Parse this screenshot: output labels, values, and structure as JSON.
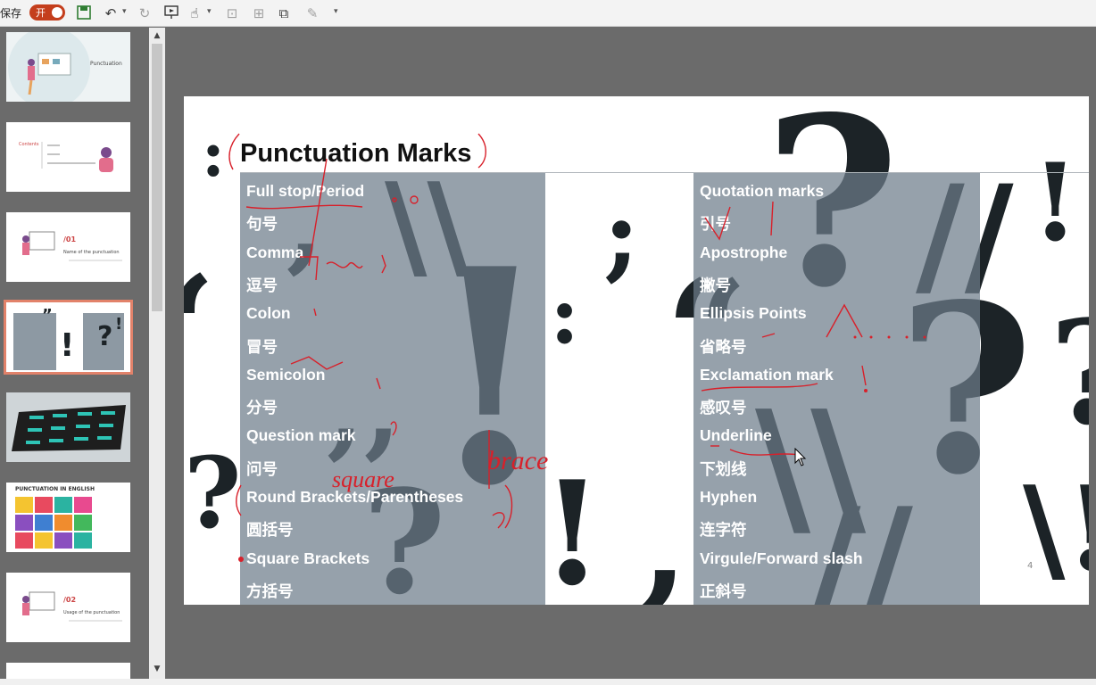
{
  "toolbar": {
    "autosave_label": "保存",
    "autosave_toggle": "开"
  },
  "thumbnails": {
    "slide1_title": "Punctuation",
    "slide2_title": "Contents",
    "slide3_num": "/01",
    "slide3_text": "Name of the punctuation",
    "slide6_title": "PUNCTUATION IN ENGLISH",
    "slide7_num": "/02",
    "slide7_text": "Usage of the punctuation"
  },
  "slide": {
    "title": "Punctuation Marks",
    "page_number": "4",
    "left_items": [
      "Full stop/Period",
      "句号",
      "Comma",
      "逗号",
      "Colon",
      "冒号",
      "Semicolon",
      "分号",
      "Question mark",
      " 问号",
      "Round Brackets/Parentheses",
      "圆括号",
      "Square Brackets",
      "方括号"
    ],
    "right_items": [
      "Quotation marks",
      "引号",
      "Apostrophe",
      " 撇号",
      "Ellipsis Points",
      "省略号",
      "Exclamation mark",
      "感叹号",
      "Underline",
      "下划线",
      "Hyphen",
      "连字符",
      "Virgule/Forward slash",
      "正斜号"
    ],
    "annotations": {
      "brace": "brace",
      "square": "square"
    }
  },
  "colors": {
    "accent": "#c43e1c",
    "panel": "#7d8b97",
    "ink": "#d8202a"
  }
}
